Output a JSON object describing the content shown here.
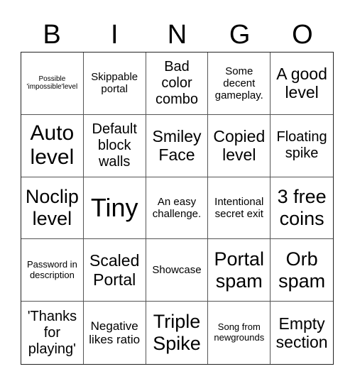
{
  "header": {
    "letters": [
      "B",
      "I",
      "N",
      "G",
      "O"
    ]
  },
  "cells": [
    {
      "text": "Possible 'impossible'level",
      "size": "s10"
    },
    {
      "text": "Skippable portal",
      "size": "s15"
    },
    {
      "text": "Bad color combo",
      "size": "s20"
    },
    {
      "text": "Some decent gameplay.",
      "size": "s15"
    },
    {
      "text": "A good level",
      "size": "s23"
    },
    {
      "text": "Auto level",
      "size": "s30"
    },
    {
      "text": "Default block walls",
      "size": "s20"
    },
    {
      "text": "Smiley Face",
      "size": "s23"
    },
    {
      "text": "Copied level",
      "size": "s23"
    },
    {
      "text": "Floating spike",
      "size": "s20"
    },
    {
      "text": "Noclip level",
      "size": "s27"
    },
    {
      "text": "Tiny",
      "size": "s36"
    },
    {
      "text": "An easy challenge.",
      "size": "s15"
    },
    {
      "text": "Intentional secret exit",
      "size": "s15"
    },
    {
      "text": "3 free coins",
      "size": "s27"
    },
    {
      "text": "Password in description",
      "size": "s13"
    },
    {
      "text": "Scaled Portal",
      "size": "s23"
    },
    {
      "text": "Showcase",
      "size": "s15"
    },
    {
      "text": "Portal spam",
      "size": "s27"
    },
    {
      "text": "Orb spam",
      "size": "s27"
    },
    {
      "text": "'Thanks for playing'",
      "size": "s20"
    },
    {
      "text": "Negative likes ratio",
      "size": "s17"
    },
    {
      "text": "Triple Spike",
      "size": "s27"
    },
    {
      "text": "Song from newgrounds",
      "size": "s13"
    },
    {
      "text": "Empty section",
      "size": "s23"
    }
  ]
}
